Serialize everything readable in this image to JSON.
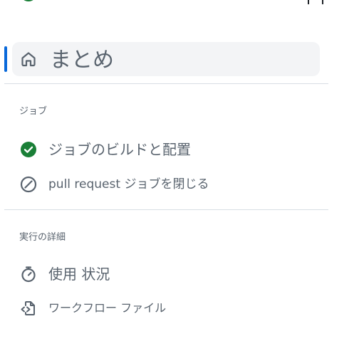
{
  "summary": {
    "label": "まとめ",
    "icon": "home-icon"
  },
  "jobs_section": {
    "heading": "ジョブ",
    "items": [
      {
        "label": "ジョブのビルドと配置",
        "icon": "check-circle-fill-icon",
        "status_color": "#1a7f37"
      },
      {
        "label": "pull request ジョブを閉じる",
        "icon": "skipped-circle-slash-icon"
      }
    ]
  },
  "run_details_section": {
    "heading": "実行の詳細",
    "items": [
      {
        "label": "使用 状況",
        "icon": "stopwatch-icon"
      },
      {
        "label": "ワークフロー ファイル",
        "icon": "file-code-icon"
      }
    ]
  },
  "colors": {
    "accent": "#0969da",
    "success": "#1a7f37",
    "muted_text": "#59636e",
    "selected_bg": "#f3f4f6",
    "divider": "#d8dee4"
  }
}
